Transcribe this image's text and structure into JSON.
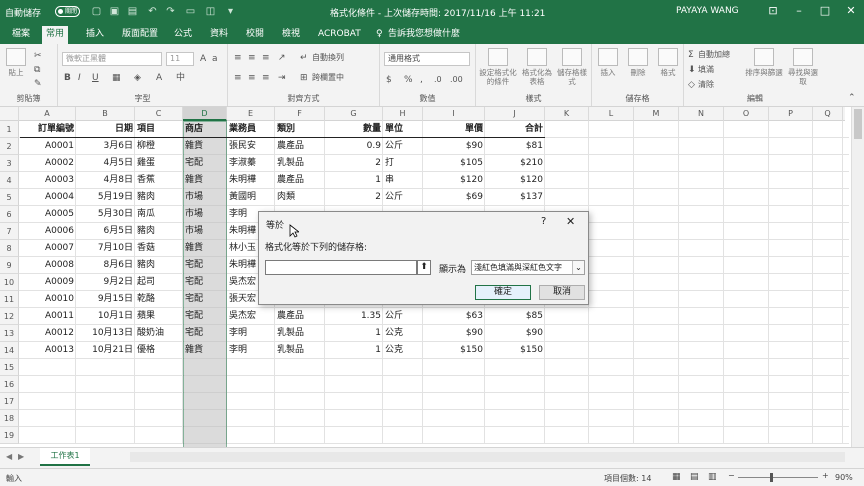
{
  "titlebar": {
    "autosave_label": "自動儲存",
    "autosave_state": "關閉",
    "doc_title": "格式化條件 - 上次儲存時間: 2017/11/16 上午 11:21",
    "user": "PAYAYA WANG"
  },
  "tabs": [
    "檔案",
    "常用",
    "插入",
    "版面配置",
    "公式",
    "資料",
    "校閱",
    "檢視",
    "ACROBAT"
  ],
  "tell_me": "告訴我您想做什麼",
  "ribbon": {
    "paste": "貼上",
    "clipboard": "剪貼簿",
    "font_name": "微軟正黑體",
    "font_size": "11",
    "font_group": "字型",
    "wrap_text": "自動換列",
    "merge_center": "跨欄置中",
    "alignment_group": "對齊方式",
    "number_format": "通用格式",
    "number_group": "數值",
    "cond_format": "設定格式化的條件",
    "format_table": "格式化為表格",
    "cell_styles": "儲存格樣式",
    "styles_group": "樣式",
    "insert": "插入",
    "delete": "刪除",
    "format": "格式",
    "cells_group": "儲存格",
    "autosum": "自動加總",
    "fill": "填滿",
    "clear": "清除",
    "sort_filter": "排序與篩選",
    "find_select": "尋找與選取",
    "editing_group": "編輯"
  },
  "columns": [
    "A",
    "B",
    "C",
    "D",
    "E",
    "F",
    "G",
    "H",
    "I",
    "J",
    "K",
    "L",
    "M",
    "N",
    "O",
    "P",
    "Q"
  ],
  "selected_column": "D",
  "headers": [
    "訂單編號",
    "日期",
    "項目",
    "商店",
    "業務員",
    "類別",
    "數量",
    "單位",
    "單價",
    "合計"
  ],
  "rows": [
    [
      "A0001",
      "3月6日",
      "柳橙",
      "雜貨",
      "張民安",
      "農產品",
      "0.9",
      "公斤",
      "$90",
      "$81"
    ],
    [
      "A0002",
      "4月5日",
      "雞蛋",
      "宅配",
      "李淑蓁",
      "乳製品",
      "2",
      "打",
      "$105",
      "$210"
    ],
    [
      "A0003",
      "4月8日",
      "香蕉",
      "雜貨",
      "朱明樺",
      "農產品",
      "1",
      "串",
      "$120",
      "$120"
    ],
    [
      "A0004",
      "5月19日",
      "豬肉",
      "市場",
      "黃國明",
      "肉類",
      "2",
      "公斤",
      "$69",
      "$137"
    ],
    [
      "A0005",
      "5月30日",
      "南瓜",
      "市場",
      "李明",
      "",
      "",
      "",
      "",
      ""
    ],
    [
      "A0006",
      "6月5日",
      "豬肉",
      "市場",
      "朱明樺",
      "",
      "",
      "",
      "",
      ""
    ],
    [
      "A0007",
      "7月10日",
      "香菇",
      "雜貨",
      "林小玉",
      "",
      "",
      "",
      "",
      ""
    ],
    [
      "A0008",
      "8月6日",
      "豬肉",
      "宅配",
      "朱明樺",
      "",
      "",
      "",
      "",
      ""
    ],
    [
      "A0009",
      "9月2日",
      "起司",
      "宅配",
      "吳杰宏",
      "",
      "",
      "",
      "",
      ""
    ],
    [
      "A0010",
      "9月15日",
      "乾酪",
      "宅配",
      "張天宏",
      "",
      "",
      "",
      "",
      ""
    ],
    [
      "A0011",
      "10月1日",
      "蘋果",
      "宅配",
      "吳杰宏",
      "農產品",
      "1.35",
      "公斤",
      "$63",
      "$85"
    ],
    [
      "A0012",
      "10月13日",
      "酸奶油",
      "宅配",
      "李明",
      "乳製品",
      "1",
      "公克",
      "$90",
      "$90"
    ],
    [
      "A0013",
      "10月21日",
      "優格",
      "雜貨",
      "李明",
      "乳製品",
      "1",
      "公克",
      "$150",
      "$150"
    ]
  ],
  "dialog": {
    "title": "等於",
    "help": "?",
    "instruction": "格式化等於下列的儲存格:",
    "input_value": "",
    "with_label": "顯示為",
    "format_option": "淺紅色填滿與深紅色文字",
    "ok": "確定",
    "cancel": "取消"
  },
  "sheet": {
    "tab": "工作表1"
  },
  "status": {
    "mode": "輸入",
    "count_label": "項目個數: 14",
    "zoom": "90%"
  },
  "colors": {
    "brand": "#217346",
    "selection_fill": "#bfbfbf"
  }
}
